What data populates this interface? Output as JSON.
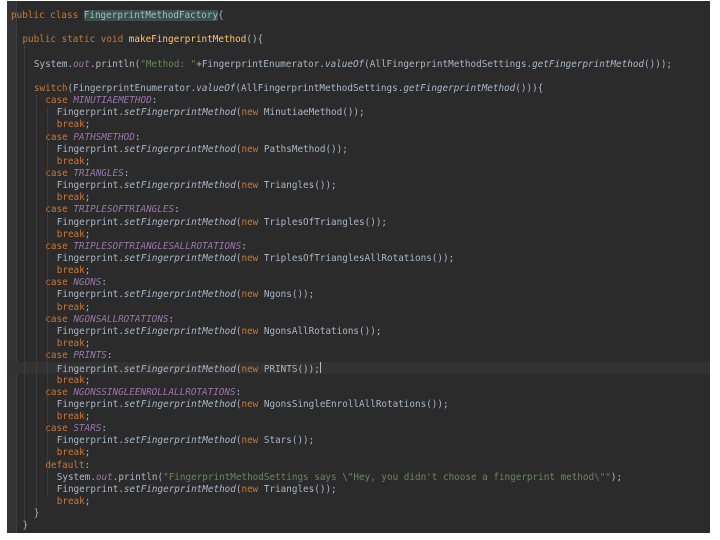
{
  "editor": {
    "lines": [
      {
        "t": 0,
        "s": [
          [
            "kw",
            "public class "
          ],
          [
            "hl",
            "FingerprintMethodFactory"
          ],
          [
            "",
            "{"
          ]
        ]
      },
      {
        "t": 0,
        "s": []
      },
      {
        "t": 2,
        "s": [
          [
            "kw",
            "public static void "
          ],
          [
            "fn",
            "makeFingerprintMethod"
          ],
          [
            "",
            "(){"
          ]
        ]
      },
      {
        "t": 0,
        "s": []
      },
      {
        "t": 4,
        "s": [
          [
            "",
            "System."
          ],
          [
            "cst",
            "out"
          ],
          [
            "",
            ".println("
          ],
          [
            "str",
            "\"Method: \""
          ],
          [
            "",
            "+FingerprintEnumerator."
          ],
          [
            "it",
            "valueOf"
          ],
          [
            "",
            "(AllFingerprintMethodSettings."
          ],
          [
            "it",
            "getFingerprintMethod"
          ],
          [
            "",
            "()));"
          ]
        ]
      },
      {
        "t": 0,
        "s": []
      },
      {
        "t": 4,
        "s": [
          [
            "kw",
            "switch"
          ],
          [
            "",
            "(FingerprintEnumerator."
          ],
          [
            "it",
            "valueOf"
          ],
          [
            "",
            "(AllFingerprintMethodSettings."
          ],
          [
            "it",
            "getFingerprintMethod"
          ],
          [
            "",
            "())){"
          ]
        ]
      },
      {
        "t": 6,
        "s": [
          [
            "kw",
            "case "
          ],
          [
            "cst",
            "MINUTIAEMETHOD"
          ],
          [
            "",
            ":"
          ]
        ]
      },
      {
        "t": 8,
        "s": [
          [
            "",
            "Fingerprint."
          ],
          [
            "it",
            "setFingerprintMethod"
          ],
          [
            "",
            "("
          ],
          [
            "kw",
            "new "
          ],
          [
            "",
            "MinutiaeMethod());"
          ]
        ]
      },
      {
        "t": 8,
        "s": [
          [
            "kw",
            "break"
          ],
          [
            "",
            ";"
          ]
        ]
      },
      {
        "t": 6,
        "s": [
          [
            "kw",
            "case "
          ],
          [
            "cst",
            "PATHSMETHOD"
          ],
          [
            "",
            ":"
          ]
        ]
      },
      {
        "t": 8,
        "s": [
          [
            "",
            "Fingerprint."
          ],
          [
            "it",
            "setFingerprintMethod"
          ],
          [
            "",
            "("
          ],
          [
            "kw",
            "new "
          ],
          [
            "",
            "PathsMethod());"
          ]
        ]
      },
      {
        "t": 8,
        "s": [
          [
            "kw",
            "break"
          ],
          [
            "",
            ";"
          ]
        ]
      },
      {
        "t": 6,
        "s": [
          [
            "kw",
            "case "
          ],
          [
            "cst",
            "TRIANGLES"
          ],
          [
            "",
            ":"
          ]
        ]
      },
      {
        "t": 8,
        "s": [
          [
            "",
            "Fingerprint."
          ],
          [
            "it",
            "setFingerprintMethod"
          ],
          [
            "",
            "("
          ],
          [
            "kw",
            "new "
          ],
          [
            "",
            "Triangles());"
          ]
        ]
      },
      {
        "t": 8,
        "s": [
          [
            "kw",
            "break"
          ],
          [
            "",
            ";"
          ]
        ]
      },
      {
        "t": 6,
        "s": [
          [
            "kw",
            "case "
          ],
          [
            "cst",
            "TRIPLESOFTRIANGLES"
          ],
          [
            "",
            ":"
          ]
        ]
      },
      {
        "t": 8,
        "s": [
          [
            "",
            "Fingerprint."
          ],
          [
            "it",
            "setFingerprintMethod"
          ],
          [
            "",
            "("
          ],
          [
            "kw",
            "new "
          ],
          [
            "",
            "TriplesOfTriangles());"
          ]
        ]
      },
      {
        "t": 8,
        "s": [
          [
            "kw",
            "break"
          ],
          [
            "",
            ";"
          ]
        ]
      },
      {
        "t": 6,
        "s": [
          [
            "kw",
            "case "
          ],
          [
            "cst",
            "TRIPLESOFTRIANGLESALLROTATIONS"
          ],
          [
            "",
            ":"
          ]
        ]
      },
      {
        "t": 8,
        "s": [
          [
            "",
            "Fingerprint."
          ],
          [
            "it",
            "setFingerprintMethod"
          ],
          [
            "",
            "("
          ],
          [
            "kw",
            "new "
          ],
          [
            "",
            "TriplesOfTrianglesAllRotations());"
          ]
        ]
      },
      {
        "t": 8,
        "s": [
          [
            "kw",
            "break"
          ],
          [
            "",
            ";"
          ]
        ]
      },
      {
        "t": 6,
        "s": [
          [
            "kw",
            "case "
          ],
          [
            "cst",
            "NGONS"
          ],
          [
            "",
            ":"
          ]
        ]
      },
      {
        "t": 8,
        "s": [
          [
            "",
            "Fingerprint."
          ],
          [
            "it",
            "setFingerprintMethod"
          ],
          [
            "",
            "("
          ],
          [
            "kw",
            "new "
          ],
          [
            "",
            "Ngons());"
          ]
        ]
      },
      {
        "t": 8,
        "s": [
          [
            "kw",
            "break"
          ],
          [
            "",
            ";"
          ]
        ]
      },
      {
        "t": 6,
        "s": [
          [
            "kw",
            "case "
          ],
          [
            "cst",
            "NGONSALLROTATIONS"
          ],
          [
            "",
            ":"
          ]
        ]
      },
      {
        "t": 8,
        "s": [
          [
            "",
            "Fingerprint."
          ],
          [
            "it",
            "setFingerprintMethod"
          ],
          [
            "",
            "("
          ],
          [
            "kw",
            "new "
          ],
          [
            "",
            "NgonsAllRotations());"
          ]
        ]
      },
      {
        "t": 8,
        "s": [
          [
            "kw",
            "break"
          ],
          [
            "",
            ";"
          ]
        ]
      },
      {
        "t": 6,
        "s": [
          [
            "kw",
            "case "
          ],
          [
            "cst",
            "PRINTS"
          ],
          [
            "",
            ":"
          ]
        ]
      },
      {
        "t": 8,
        "s": [
          [
            "",
            "Fingerprint."
          ],
          [
            "it",
            "setFingerprintMethod"
          ],
          [
            "",
            "("
          ],
          [
            "kw",
            "new "
          ],
          [
            "",
            "PRINTS());"
          ]
        ],
        "current": true
      },
      {
        "t": 8,
        "s": [
          [
            "kw",
            "break"
          ],
          [
            "",
            ";"
          ]
        ]
      },
      {
        "t": 6,
        "s": [
          [
            "kw",
            "case "
          ],
          [
            "cst",
            "NGONSSINGLEENROLLALLROTATIONS"
          ],
          [
            "",
            ":"
          ]
        ]
      },
      {
        "t": 8,
        "s": [
          [
            "",
            "Fingerprint."
          ],
          [
            "it",
            "setFingerprintMethod"
          ],
          [
            "",
            "("
          ],
          [
            "kw",
            "new "
          ],
          [
            "",
            "NgonsSingleEnrollAllRotations());"
          ]
        ]
      },
      {
        "t": 8,
        "s": [
          [
            "kw",
            "break"
          ],
          [
            "",
            ";"
          ]
        ]
      },
      {
        "t": 6,
        "s": [
          [
            "kw",
            "case "
          ],
          [
            "cst",
            "STARS"
          ],
          [
            "",
            ":"
          ]
        ]
      },
      {
        "t": 8,
        "s": [
          [
            "",
            "Fingerprint."
          ],
          [
            "it",
            "setFingerprintMethod"
          ],
          [
            "",
            "("
          ],
          [
            "kw",
            "new "
          ],
          [
            "",
            "Stars());"
          ]
        ]
      },
      {
        "t": 8,
        "s": [
          [
            "kw",
            "break"
          ],
          [
            "",
            ";"
          ]
        ]
      },
      {
        "t": 6,
        "s": [
          [
            "kw",
            "default"
          ],
          [
            "",
            ":"
          ]
        ]
      },
      {
        "t": 8,
        "s": [
          [
            "",
            "System."
          ],
          [
            "cst",
            "out"
          ],
          [
            "",
            ".println("
          ],
          [
            "str",
            "\"FingerprintMethodSettings says \\\"Hey, you didn't choose a fingerprint method\\\"\""
          ],
          [
            "",
            "); "
          ]
        ]
      },
      {
        "t": 8,
        "s": [
          [
            "",
            "Fingerprint."
          ],
          [
            "it",
            "setFingerprintMethod"
          ],
          [
            "",
            "("
          ],
          [
            "kw",
            "new "
          ],
          [
            "",
            "Triangles());"
          ]
        ]
      },
      {
        "t": 8,
        "s": [
          [
            "kw",
            "break"
          ],
          [
            "",
            ";"
          ]
        ]
      },
      {
        "t": 4,
        "s": [
          [
            "br",
            "}"
          ]
        ]
      },
      {
        "t": 2,
        "s": [
          [
            "br",
            "}"
          ]
        ]
      }
    ]
  }
}
